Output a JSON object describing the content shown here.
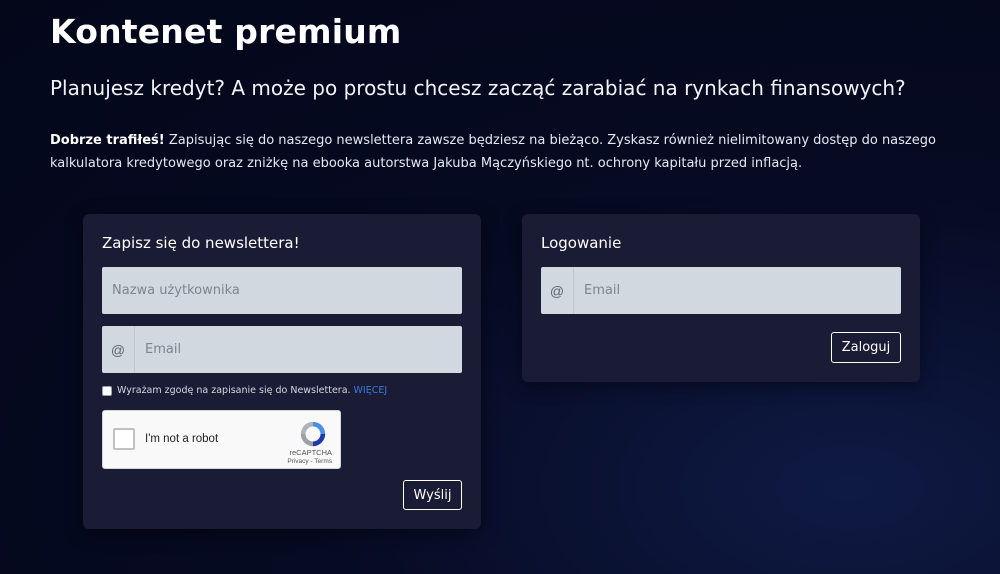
{
  "header": {
    "title": "Kontenet premium",
    "subtitle": "Planujesz kredyt? A może po prostu chcesz zacząć zarabiać na rynkach finansowych?",
    "intro_bold": "Dobrze trafiłeś!",
    "intro_text": " Zapisując się do naszego newslettera zawsze będziesz na bieżąco. Zyskasz również nielimitowany dostęp do naszego kalkulatora kredytowego oraz zniżkę na ebooka autorstwa Jakuba Mączyńskiego nt. ochrony kapitału przed inflacją."
  },
  "newsletter": {
    "title": "Zapisz się do newslettera!",
    "username_placeholder": "Nazwa użytkownika",
    "email_prefix": "@",
    "email_placeholder": "Email",
    "consent_text": "Wyrażam zgodę na zapisanie się do Newslettera.",
    "consent_more": "WIĘCEJ",
    "recaptcha": {
      "label": "I'm not a robot",
      "brand": "reCAPTCHA",
      "links": "Privacy - Terms"
    },
    "submit_label": "Wyślij"
  },
  "login": {
    "title": "Logowanie",
    "email_prefix": "@",
    "email_placeholder": "Email",
    "submit_label": "Zaloguj"
  },
  "colors": {
    "background": "#060a22",
    "card": "#1a1b34",
    "input": "#d2d8df",
    "link": "#3b78d8"
  }
}
